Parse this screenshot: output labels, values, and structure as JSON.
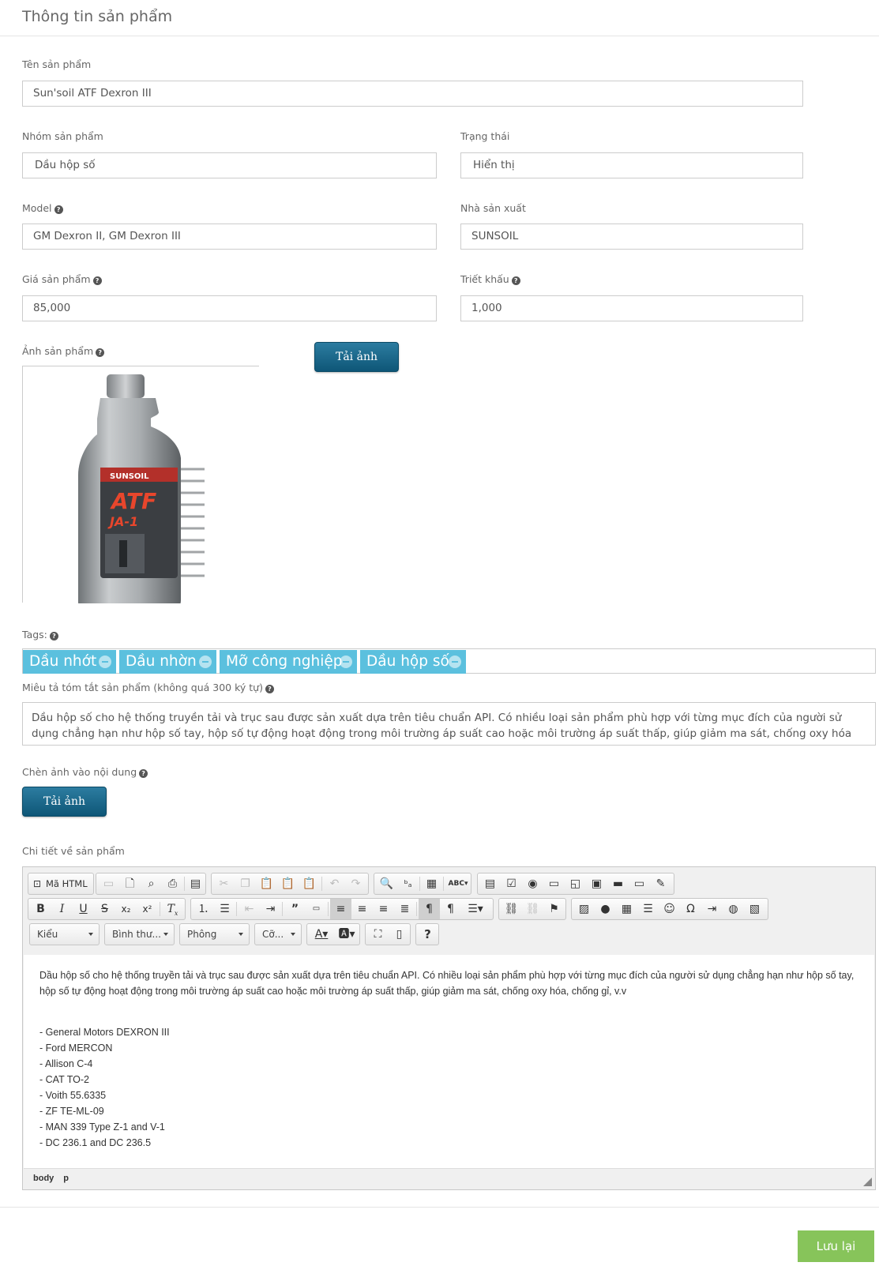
{
  "page": {
    "title": "Thông tin sản phẩm"
  },
  "form": {
    "name": {
      "label": "Tên sản phẩm",
      "value": "Sun'soil ATF Dexron III"
    },
    "group": {
      "label": "Nhóm sản phẩm",
      "value": "Dầu hộp số"
    },
    "status": {
      "label": "Trạng thái",
      "value": "Hiển thị"
    },
    "model": {
      "label": "Model",
      "value": "GM Dexron II,  GM Dexron III"
    },
    "manufacturer": {
      "label": "Nhà sản xuất",
      "value": "SUNSOIL"
    },
    "price": {
      "label": "Giá sản phẩm",
      "value": "85,000"
    },
    "discount": {
      "label": "Triết khấu",
      "value": "1,000"
    },
    "image": {
      "label": "Ảnh sản phẩm",
      "upload_label": "Tải ảnh",
      "bottle_brand": "SUNSOIL",
      "bottle_product": "ATF",
      "bottle_sub": "JA-1"
    },
    "tags": {
      "label": "Tags:",
      "items": [
        "Dầu nhớt",
        "Dầu nhờn",
        "Mỡ công nghiệp",
        "Dầu hộp số"
      ]
    },
    "summary": {
      "label": "Miêu tả tóm tắt sản phẩm (không quá 300 ký tự)",
      "value": "Dầu hộp số cho hệ thống truyền tải và trục sau được sản xuất  dựa trên tiêu chuẩn API. Có nhiều loại sản phẩm phù hợp với từng  mục đích của người sử dụng chẳng hạn như hộp số tay, hộp số tự động hoạt động trong môi trường áp suất cao hoặc môi trường áp suất thấp, giúp giảm ma sát, chống oxy hóa"
    },
    "insert_image": {
      "label": "Chèn ảnh vào nội dung",
      "upload_label": "Tải ảnh"
    },
    "details": {
      "label": "Chi tiết về sản phẩm"
    }
  },
  "editor": {
    "source_label": "Mã HTML",
    "combos": {
      "style": "Kiểu",
      "format": "Bình thư...",
      "font": "Phông",
      "size": "Cỡ..."
    },
    "content": {
      "paragraph": "Dầu hộp số cho hệ thống truyền tải và trục sau được sản xuất  dựa trên tiêu chuẩn API. Có nhiều loại sản phẩm phù hợp với từng  mục đích của người sử dụng chẳng hạn như hộp số tay, hộp số tự động hoạt động trong môi trường áp suất cao hoặc môi trường áp suất thấp, giúp giảm ma sát, chống oxy hóa, chống gỉ, v.v",
      "list": [
        "- General Motors DEXRON III",
        "- Ford MERCON",
        "- Allison C-4",
        "- CAT TO-2",
        "- Voith 55.6335",
        "- ZF TE-ML-09",
        "- MAN 339 Type Z-1 and V-1",
        "- DC 236.1 and DC 236.5"
      ]
    },
    "path": [
      "body",
      "p"
    ]
  },
  "actions": {
    "save_label": "Lưu lại"
  },
  "colors": {
    "tag": "#5bc0de",
    "upload_button": "#145f82",
    "save_button": "#87c45a"
  }
}
